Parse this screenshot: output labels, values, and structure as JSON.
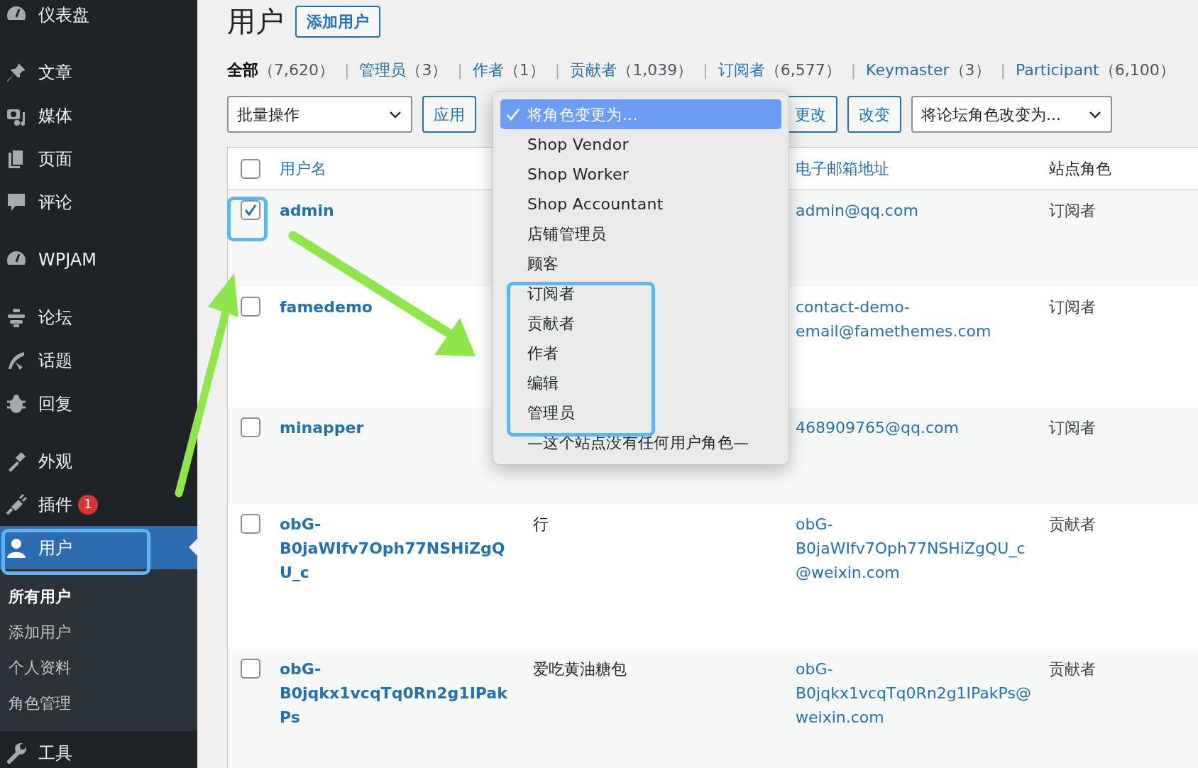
{
  "sidebar": {
    "groups": [
      [
        {
          "label": "仪表盘",
          "selected": false
        }
      ],
      [
        {
          "label": "文章",
          "selected": false
        },
        {
          "label": "媒体",
          "selected": false
        },
        {
          "label": "页面",
          "selected": false
        },
        {
          "label": "评论",
          "selected": false
        }
      ],
      [
        {
          "label": "WPJAM",
          "selected": false
        }
      ],
      [
        {
          "label": "论坛",
          "selected": false
        },
        {
          "label": "话题",
          "selected": false
        },
        {
          "label": "回复",
          "selected": false
        }
      ],
      [
        {
          "label": "外观",
          "selected": false
        },
        {
          "label": "插件",
          "selected": false,
          "badge": "1"
        },
        {
          "label": "用户",
          "selected": true,
          "children": [
            {
              "label": "所有用户",
              "selected": true
            },
            {
              "label": "添加用户",
              "selected": false
            },
            {
              "label": "个人资料",
              "selected": false
            },
            {
              "label": "角色管理",
              "selected": false
            }
          ]
        },
        {
          "label": "工具",
          "selected": false
        }
      ]
    ]
  },
  "page": {
    "title": "用户",
    "add_button": "添加用户"
  },
  "filters": [
    {
      "label": "全部",
      "count": "（7,620）",
      "selected": true
    },
    {
      "separator": "|",
      "label": "管理员",
      "count": "（3）",
      "selected": false
    },
    {
      "separator": "|",
      "label": "作者",
      "count": "（1）",
      "selected": false
    },
    {
      "separator": "|",
      "label": "贡献者",
      "count": "（1,039）",
      "selected": false
    },
    {
      "separator": "|",
      "label": "订阅者",
      "count": "（6,577）",
      "selected": false
    },
    {
      "separator": "|",
      "label": "Keymaster",
      "count": "（3）",
      "selected": false
    },
    {
      "separator": "|",
      "label": "Participant",
      "count": "（6,100）",
      "selected": false
    }
  ],
  "bulk": {
    "action_select": "批量操作",
    "apply_button": "应用",
    "change_button": "更改",
    "change_button_2": "改变",
    "forum_role_select": "将论坛角色改变为..."
  },
  "role_menu": {
    "items": [
      {
        "label": "将角色变更为...",
        "selected": true
      },
      {
        "label": "Shop Vendor",
        "selected": false
      },
      {
        "label": "Shop Worker",
        "selected": false
      },
      {
        "label": "Shop Accountant",
        "selected": false
      },
      {
        "label": "店铺管理员",
        "selected": false
      },
      {
        "label": "顾客",
        "selected": false
      },
      {
        "label": "订阅者",
        "selected": false
      },
      {
        "label": "贡献者",
        "selected": false
      },
      {
        "label": "作者",
        "selected": false
      },
      {
        "label": "编辑",
        "selected": false
      },
      {
        "label": "管理员",
        "selected": false
      },
      {
        "label": "—这个站点没有任何用户角色—",
        "selected": false
      }
    ]
  },
  "table": {
    "select_all_checked": false,
    "columns": {
      "username": "用户名",
      "email": "电子邮箱地址",
      "role": "站点角色"
    },
    "rows": [
      {
        "checked": true,
        "username": "admin",
        "email": "admin@qq.com",
        "role": "订阅者"
      },
      {
        "checked": false,
        "username": "famedemo",
        "email": "contact-demo-email@famethemes.com",
        "role": "订阅者"
      },
      {
        "checked": false,
        "username": "minapper",
        "email": "468909765@qq.com",
        "role": "订阅者"
      },
      {
        "checked": false,
        "username": "obG-B0jaWIfv7Oph77NSHiZgQU_c",
        "name": "行",
        "email": "obG-B0jaWIfv7Oph77NSHiZgQU_c@weixin.com",
        "role": "贡献者"
      },
      {
        "checked": false,
        "username": "obG-B0jqkx1vcqTq0Rn2g1IPakPs",
        "name": "爱吃黄油糖包",
        "email": "obG-B0jqkx1vcqTq0Rn2g1IPakPs@weixin.com",
        "role": "贡献者"
      }
    ]
  }
}
